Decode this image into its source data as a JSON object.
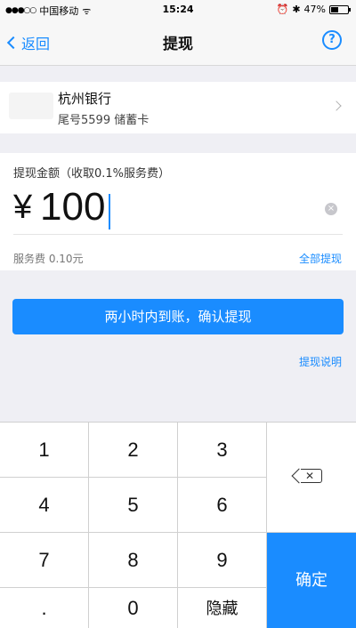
{
  "status_bar": {
    "signal": "●●●○○",
    "carrier": "中国移动",
    "wifi": "ᯤ",
    "time": "15:24",
    "alarm": "⏰",
    "bluetooth": "✱",
    "battery_text": "47%",
    "battery_level": 0.47
  },
  "nav": {
    "back_label": "返回",
    "title": "提现",
    "help_label": "?"
  },
  "bank": {
    "name": "杭州银行",
    "card": "尾号5599 储蓄卡"
  },
  "amount": {
    "label": "提现金额（收取0.1%服务费）",
    "currency": "¥",
    "value": "100",
    "clear_label": "×",
    "fee": "服务费 0.10元",
    "withdraw_all": "全部提现"
  },
  "confirm_button": "两小时内到账，确认提现",
  "explain_link": "提现说明",
  "keypad": {
    "keys": [
      "1",
      "2",
      "3",
      "4",
      "5",
      "6",
      "7",
      "8",
      "9",
      ".",
      "0",
      "隐藏"
    ],
    "backspace_icon": "backspace-icon",
    "ok_label": "确定"
  },
  "colors": {
    "accent": "#1a8cff",
    "background": "#efeff4"
  }
}
